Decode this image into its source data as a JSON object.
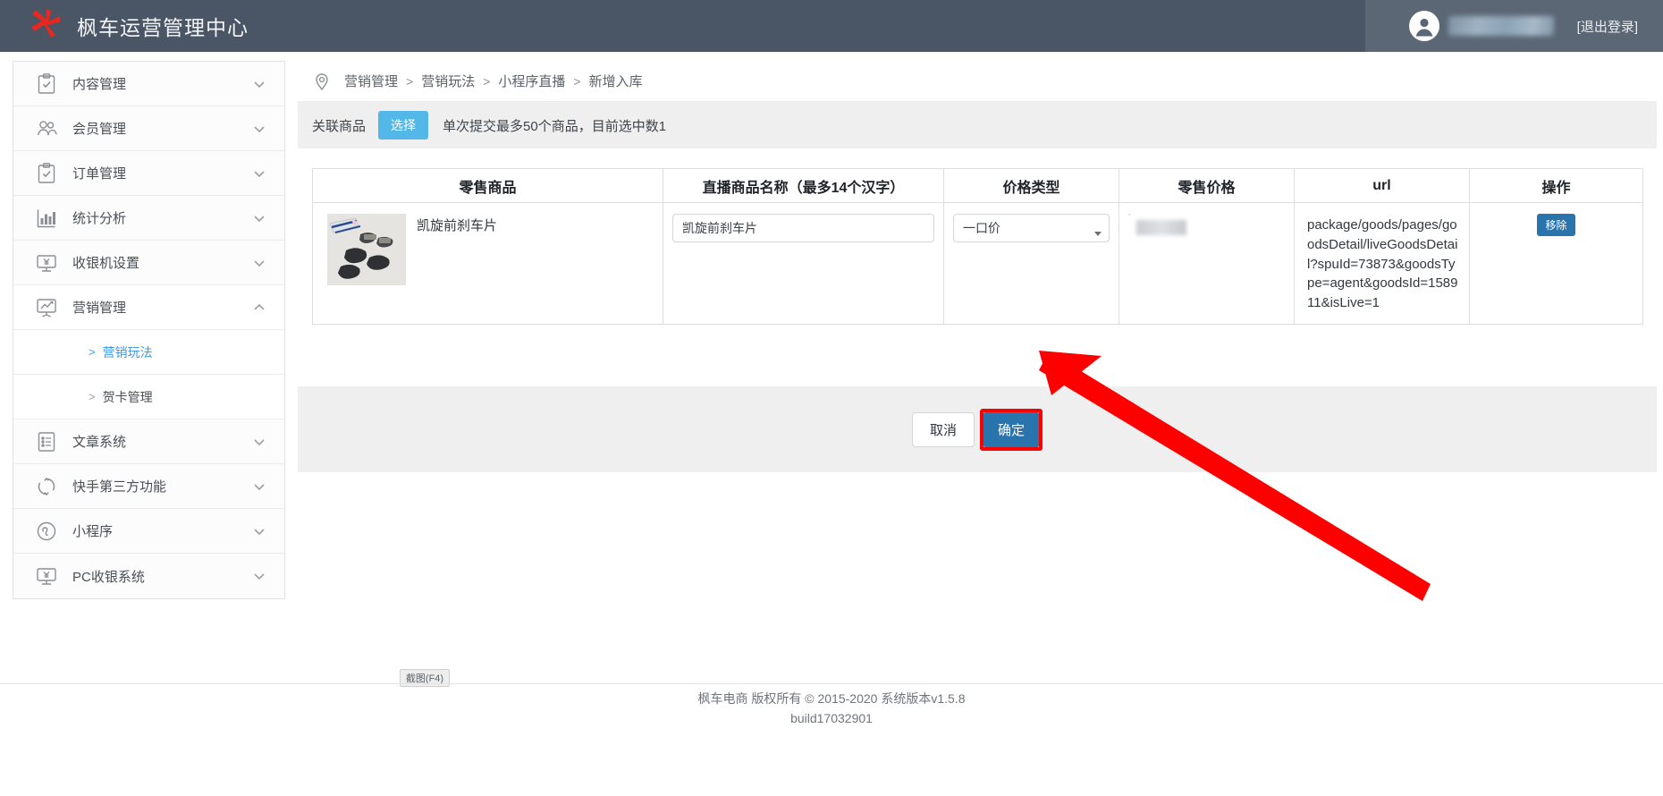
{
  "header": {
    "logo_icon": "maple-windmill-logo",
    "app_title": "枫车运营管理中心",
    "avatar_icon": "user-avatar-icon",
    "username_masked": "",
    "logout_label": "[退出登录]"
  },
  "sidebar": {
    "items": [
      {
        "label": "内容管理",
        "icon": "clipboard-check-icon",
        "chevron": "chevron-down-icon",
        "expanded": false
      },
      {
        "label": "会员管理",
        "icon": "users-icon",
        "chevron": "chevron-down-icon",
        "expanded": false
      },
      {
        "label": "订单管理",
        "icon": "clipboard-check-icon",
        "chevron": "chevron-down-icon",
        "expanded": false
      },
      {
        "label": "统计分析",
        "icon": "bar-chart-icon",
        "chevron": "chevron-down-icon",
        "expanded": false
      },
      {
        "label": "收银机设置",
        "icon": "monitor-yen-icon",
        "chevron": "chevron-down-icon",
        "expanded": false
      },
      {
        "label": "营销管理",
        "icon": "presentation-chart-icon",
        "chevron": "chevron-up-icon",
        "expanded": true
      },
      {
        "label": "文章系统",
        "icon": "list-document-icon",
        "chevron": "chevron-down-icon",
        "expanded": false
      },
      {
        "label": "快手第三方功能",
        "icon": "circular-arrows-icon",
        "chevron": "chevron-down-icon",
        "expanded": false
      },
      {
        "label": "小程序",
        "icon": "miniprogram-circle-icon",
        "chevron": "chevron-down-icon",
        "expanded": false
      },
      {
        "label": "PC收银系统",
        "icon": "monitor-yen-icon",
        "chevron": "chevron-down-icon",
        "expanded": false
      }
    ],
    "sub_items": [
      {
        "label": "营销玩法",
        "arrow": ">",
        "active": true
      },
      {
        "label": "贺卡管理",
        "arrow": ">",
        "active": false
      }
    ],
    "accent_active": "#3f9ae5"
  },
  "breadcrumb": {
    "pin_icon": "location-pin-icon",
    "separator": ">",
    "items": [
      "营销管理",
      "营销玩法",
      "小程序直播",
      "新增入库"
    ]
  },
  "assoc_bar": {
    "label": "关联商品",
    "select_button": "选择",
    "hint": "单次提交最多50个商品，目前选中数1",
    "select_button_color": "#53b7e8"
  },
  "table": {
    "headers": [
      "零售商品",
      "直播商品名称（最多14个汉字）",
      "价格类型",
      "零售价格",
      "url",
      "操作"
    ],
    "rows": [
      {
        "product_name": "凯旋前刹车片",
        "product_image_alt": "brake-pads-photo",
        "live_name_value": "凯旋前刹车片",
        "live_name_placeholder": "",
        "price_type_selected": "一口价",
        "price_type_options": [
          "一口价"
        ],
        "retail_price_value": "",
        "url": "package/goods/pages/goodsDetail/liveGoodsDetail?spuId=73873&goodsType=agent&goodsId=158911&isLive=1",
        "remove_label": "移除",
        "remove_color": "#2a74ad"
      }
    ]
  },
  "actions": {
    "cancel_label": "取消",
    "confirm_label": "确定",
    "confirm_color": "#2a74ad",
    "highlight_color": "#ff0000"
  },
  "overlay": {
    "snip_chip_label": "截图(F4)"
  },
  "footer": {
    "line1": "枫车电商 版权所有 © 2015-2020 系统版本v1.5.8",
    "line2": "build17032901"
  }
}
